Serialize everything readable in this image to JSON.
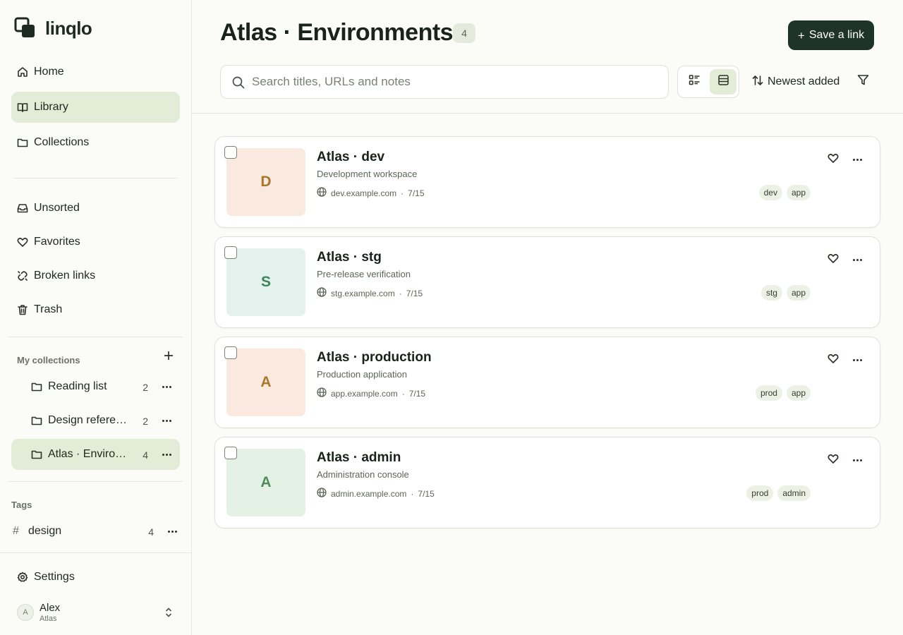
{
  "app": {
    "name": "linqlo"
  },
  "nav": {
    "home": "Home",
    "library": "Library",
    "collections": "Collections",
    "unsorted": "Unsorted",
    "favorites": "Favorites",
    "broken_links": "Broken links",
    "trash": "Trash"
  },
  "my_collections": {
    "label": "My collections",
    "items": [
      {
        "label": "Reading list",
        "count": "2"
      },
      {
        "label": "Design references",
        "count": "2"
      },
      {
        "label": "Atlas · Environments",
        "count": "4"
      }
    ]
  },
  "tags": {
    "label": "Tags",
    "items": [
      {
        "label": "design",
        "count": "4"
      }
    ]
  },
  "settings": "Settings",
  "user": {
    "initial": "A",
    "name": "Alex",
    "workspace": "Atlas"
  },
  "header": {
    "title": "Atlas · Environments",
    "count": "4",
    "save_label": "Save a link",
    "search_placeholder": "Search titles, URLs and notes",
    "sort_label": "Newest added"
  },
  "items": [
    {
      "letter": "D",
      "title": "Atlas · dev",
      "description": "Development workspace",
      "domain": "dev.example.com",
      "date": "7/15",
      "tags": [
        "dev",
        "app"
      ],
      "thumb_bg": "#f9e9de",
      "thumb_fg": "#a8772b"
    },
    {
      "letter": "S",
      "title": "Atlas · stg",
      "description": "Pre-release verification",
      "domain": "stg.example.com",
      "date": "7/15",
      "tags": [
        "stg",
        "app"
      ],
      "thumb_bg": "#e3f2ec",
      "thumb_fg": "#3c8658"
    },
    {
      "letter": "A",
      "title": "Atlas · production",
      "description": "Production application",
      "domain": "app.example.com",
      "date": "7/15",
      "tags": [
        "prod",
        "app"
      ],
      "thumb_bg": "#fbe8df",
      "thumb_fg": "#a8772b"
    },
    {
      "letter": "A",
      "title": "Atlas · admin",
      "description": "Administration console",
      "domain": "admin.example.com",
      "date": "7/15",
      "tags": [
        "prod",
        "admin"
      ],
      "thumb_bg": "#e4f2e6",
      "thumb_fg": "#4f8c57"
    }
  ],
  "colors": {
    "accent_dark": "#1e3428",
    "active_bg": "#e3ecd7",
    "tag_bg": "#edf1e5"
  },
  "icons": {
    "home": "home-icon",
    "library": "book-icon",
    "collections": "folder-icon",
    "unsorted": "inbox-icon",
    "favorites": "heart-icon",
    "broken_links": "broken-link-icon",
    "trash": "trash-icon",
    "settings": "gear-icon"
  }
}
